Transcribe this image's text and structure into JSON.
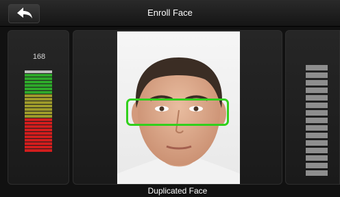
{
  "header": {
    "title": "Enroll Face",
    "back_icon": "back-arrow-icon"
  },
  "quality_meter": {
    "score": "168",
    "segments": [
      "#bdbdbd",
      "#2ea82a",
      "#2ea82a",
      "#2ea82a",
      "#2ea82a",
      "#2ea82a",
      "#2ea82a",
      "#9d9a2a",
      "#9d9a2a",
      "#9d9a2a",
      "#9d9a2a",
      "#9d9a2a",
      "#9d9a2a",
      "#9d9a2a",
      "#d11d1d",
      "#d11d1d",
      "#d11d1d",
      "#d11d1d",
      "#d11d1d",
      "#d11d1d",
      "#d11d1d",
      "#d11d1d",
      "#d11d1d",
      "#d11d1d"
    ]
  },
  "camera": {
    "face_box_color": "#31d01c",
    "status": "Duplicated Face"
  },
  "progress": {
    "total_steps": 15,
    "completed_steps": 0
  }
}
